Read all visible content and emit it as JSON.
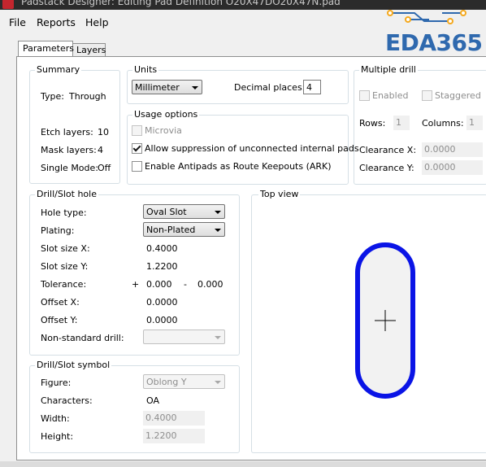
{
  "window": {
    "title": "Padstack Designer: Editing Pad Definition O20X47DO20X47N.pad"
  },
  "menu": {
    "file": "File",
    "reports": "Reports",
    "help": "Help"
  },
  "logo": {
    "text": "EDA365",
    "color": "#2f69ae",
    "accent": "#f4a81d"
  },
  "tabs": {
    "parameters": "Parameters",
    "layers": "Layers"
  },
  "summary": {
    "title": "Summary",
    "type_label": "Type:",
    "type_value": "Through",
    "etch_label": "Etch layers:",
    "etch_value": "10",
    "mask_label": "Mask layers:",
    "mask_value": "4",
    "single_label": "Single Mode:",
    "single_value": "Off"
  },
  "units": {
    "title": "Units",
    "unit_value": "Millimeter",
    "decimal_label": "Decimal places:",
    "decimal_value": "4"
  },
  "usage": {
    "title": "Usage options",
    "microvia": "Microvia",
    "allow_suppression": "Allow suppression of unconnected internal pads",
    "antipads": "Enable Antipads as Route Keepouts (ARK)"
  },
  "multiple_drill": {
    "title": "Multiple drill",
    "enabled": "Enabled",
    "staggered": "Staggered",
    "rows_label": "Rows:",
    "rows_value": "1",
    "columns_label": "Columns:",
    "columns_value": "1",
    "clearance_x_label": "Clearance X:",
    "clearance_x_value": "0.0000",
    "clearance_y_label": "Clearance Y:",
    "clearance_y_value": "0.0000"
  },
  "drill_hole": {
    "title": "Drill/Slot hole",
    "hole_type_label": "Hole type:",
    "hole_type_value": "Oval Slot",
    "plating_label": "Plating:",
    "plating_value": "Non-Plated",
    "slot_x_label": "Slot size X:",
    "slot_x_value": "0.4000",
    "slot_y_label": "Slot size Y:",
    "slot_y_value": "1.2200",
    "tolerance_label": "Tolerance:",
    "tol_plus": "+",
    "tol_plus_value": "0.000",
    "tol_minus": "-",
    "tol_minus_value": "0.000",
    "offset_x_label": "Offset X:",
    "offset_x_value": "0.0000",
    "offset_y_label": "Offset Y:",
    "offset_y_value": "0.0000",
    "nonstd_label": "Non-standard drill:",
    "nonstd_value": ""
  },
  "drill_symbol": {
    "title": "Drill/Slot symbol",
    "figure_label": "Figure:",
    "figure_value": "Oblong Y",
    "characters_label": "Characters:",
    "characters_value": "OA",
    "width_label": "Width:",
    "width_value": "0.4000",
    "height_label": "Height:",
    "height_value": "1.2200"
  },
  "top_view": {
    "title": "Top view",
    "slot_color": "#0a14e6"
  }
}
